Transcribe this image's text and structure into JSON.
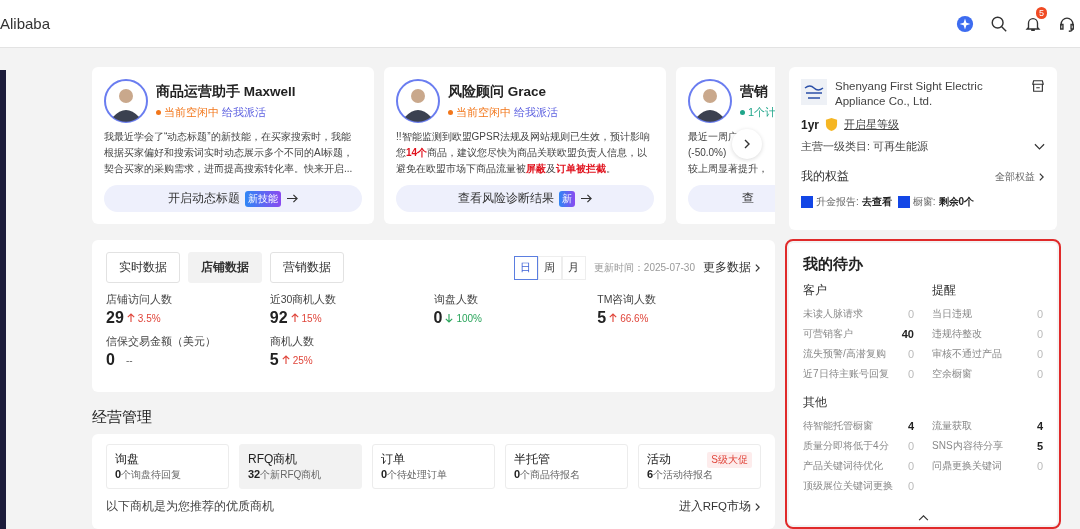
{
  "header": {
    "brand": "Alibaba",
    "notification_count": "5"
  },
  "agents": [
    {
      "name": "商品运营助手 Maxwell",
      "status": "当前空闲中",
      "color": "#f2761a",
      "action": "给我派活",
      "desc_lines": [
        "我最近学会了“动态标题”的新技能，在买家搜索时，我能",
        "根据买家偏好和搜索词实时动态展示多个不同的AI标题，",
        "契合买家的采购需求，进而提高搜索转化率。快来开启..."
      ],
      "button": "开启动态标题",
      "button_badge": "新技能"
    },
    {
      "name": "风险顾问 Grace",
      "status": "当前空闲中",
      "color": "#f2761a",
      "action": "给我派活",
      "desc_lines": [
        "!!智能监测到欧盟GPSR法规及网站规则已生效，预计影响",
        "您**14个**商品，建议您尽快为商品关联欧盟负责人信息，以",
        "避免在欧盟市场下商品流量被**屏蔽**及**订单被拦截**。"
      ],
      "button": "查看风险诊断结果",
      "button_badge": "新"
    },
    {
      "name": "营销",
      "status": "1个计",
      "color": "#1fa58a",
      "desc_lines": [
        "最近一周广",
        "(-50.0%)",
        "较上周显著提升，"
      ],
      "button": "查"
    }
  ],
  "data_panel": {
    "tabs": [
      {
        "label": "实时数据",
        "selected": false
      },
      {
        "label": "店铺数据",
        "selected": true
      },
      {
        "label": "营销数据",
        "selected": false
      }
    ],
    "periods": [
      {
        "label": "日",
        "selected": true
      },
      {
        "label": "周",
        "selected": false
      },
      {
        "label": "月",
        "selected": false
      }
    ],
    "updated": "更新时间：2025-07-30",
    "more": "更多数据",
    "metrics": [
      {
        "label": "店铺访问人数",
        "value": "29",
        "change": "3.5%",
        "kind": "up"
      },
      {
        "label": "近30商机人数",
        "value": "92",
        "change": "15%",
        "kind": "up"
      },
      {
        "label": "询盘人数",
        "value": "0",
        "change": "100%",
        "kind": "down"
      },
      {
        "label": "TM咨询人数",
        "value": "5",
        "change": "66.6%",
        "kind": "up"
      },
      {
        "label": "信保交易金额（美元）",
        "value": "0",
        "change": "--",
        "kind": "none"
      },
      {
        "label": "商机人数",
        "value": "5",
        "change": "25%",
        "kind": "up"
      }
    ]
  },
  "management": {
    "title": "经营管理",
    "tiles": [
      {
        "title": "询盘",
        "count": "0",
        "text": "个询盘待回复",
        "selected": false
      },
      {
        "title": "RFQ商机",
        "count": "32",
        "text": "个新RFQ商机",
        "selected": true
      },
      {
        "title": "订单",
        "count": "0",
        "text": "个待处理订单",
        "selected": false
      },
      {
        "title": "半托管",
        "count": "0",
        "text": "个商品待报名",
        "selected": false
      },
      {
        "title": "活动",
        "count": "6",
        "text": "个活动待报名",
        "selected": false,
        "tag": "S级大促"
      }
    ],
    "footer": "以下商机是为您推荐的优质商机",
    "link": "进入RFQ市场"
  },
  "company": {
    "name": "Shenyang First Sight Electric Appliance Co., Ltd.",
    "years": "1yr",
    "star_link": "开启星等级",
    "category": "主营一级类目: 可再生能源",
    "benefits_title": "我的权益",
    "benefits_link": "全部权益",
    "benefits": [
      {
        "label": "升金报告:",
        "value": "去查看"
      },
      {
        "label": "橱窗:",
        "value": "剩余0个"
      }
    ]
  },
  "todo": {
    "title": "我的待办",
    "columns": [
      {
        "title": "客户",
        "items": [
          {
            "label": "未读人脉请求",
            "count": "0",
            "emphasis": false
          },
          {
            "label": "可营销客户",
            "count": "40",
            "emphasis": true
          },
          {
            "label": "流失预警/高潜复购",
            "count": "0",
            "emphasis": false
          },
          {
            "label": "近7日待主账号回复",
            "count": "0",
            "emphasis": false
          }
        ]
      },
      {
        "title": "提醒",
        "items": [
          {
            "label": "当日违规",
            "count": "0",
            "emphasis": false
          },
          {
            "label": "违规待整改",
            "count": "0",
            "emphasis": false
          },
          {
            "label": "审核不通过产品",
            "count": "0",
            "emphasis": false
          },
          {
            "label": "空余橱窗",
            "count": "0",
            "emphasis": false
          }
        ]
      }
    ],
    "other": {
      "title": "其他",
      "items": [
        {
          "label": "待智能托管橱窗",
          "count": "4",
          "emphasis": true
        },
        {
          "label": "流量获取",
          "count": "4",
          "emphasis": true
        },
        {
          "label": "质量分即将低于4分",
          "count": "0",
          "emphasis": false
        },
        {
          "label": "SNS内容待分享",
          "count": "5",
          "emphasis": true
        },
        {
          "label": "产品关键词待优化",
          "count": "0",
          "emphasis": false
        },
        {
          "label": "问鼎更换关键词",
          "count": "0",
          "emphasis": false
        },
        {
          "label": "顶级展位关键词更换",
          "count": "0",
          "emphasis": false
        }
      ]
    }
  }
}
